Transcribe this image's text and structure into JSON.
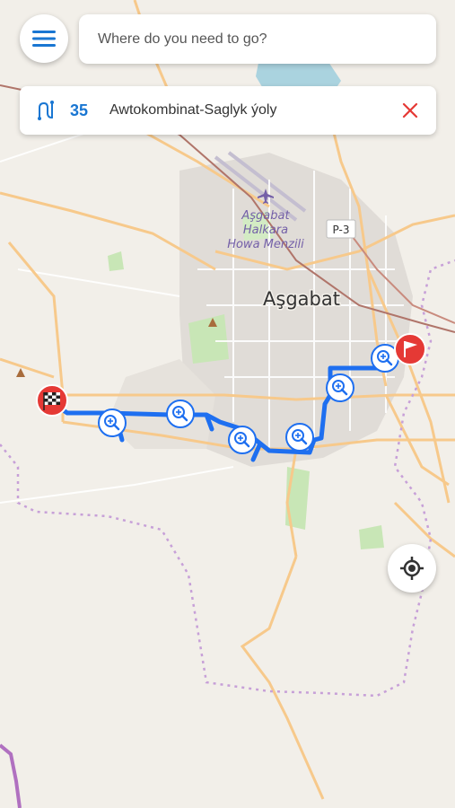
{
  "search": {
    "placeholder": "Where do you need to go?"
  },
  "route": {
    "number": "35",
    "name": "Awtokombinat-Saglyk ýoly"
  },
  "map_labels": {
    "city": "Aşgabat",
    "airport_line1": "Aşgabat",
    "airport_line2": "Halkara",
    "airport_line3": "Howa Menzili",
    "road_shield": "P-3"
  },
  "colors": {
    "route_line": "#1e6ff0",
    "accent": "#1976d2",
    "close": "#e53935",
    "flag_red": "#e53935"
  },
  "icons": {
    "menu": "hamburger-menu-icon",
    "route": "route-icon",
    "close": "close-icon",
    "locate": "my-location-icon",
    "stop": "zoom-in-stop-icon",
    "start": "checkered-flag-icon",
    "end": "red-flag-icon"
  }
}
